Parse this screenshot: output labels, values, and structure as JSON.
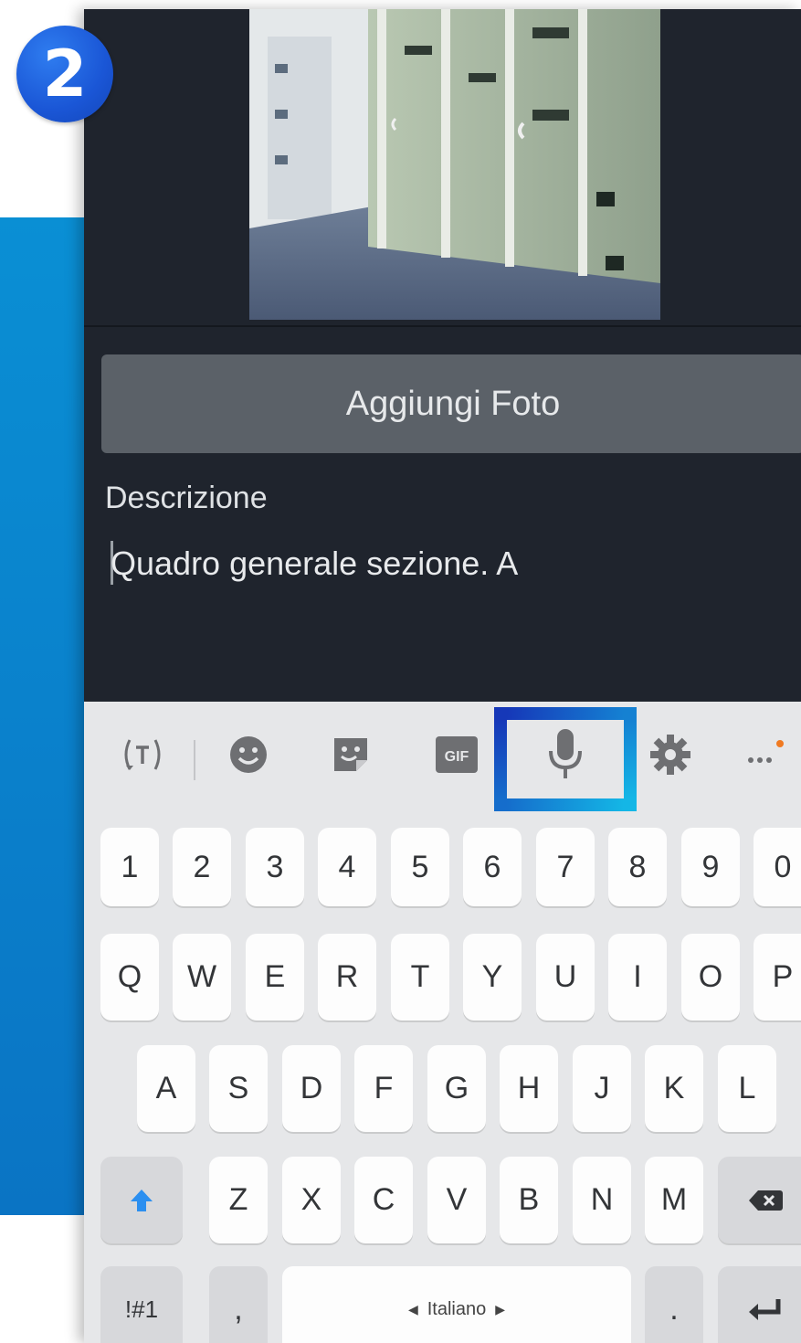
{
  "step": {
    "number": "2"
  },
  "form": {
    "add_photo_button": "Aggiungi Foto",
    "description_label": "Descrizione",
    "description_value": "Quadro generale sezione. A"
  },
  "keyboard": {
    "toolbar": [
      "text-translate-icon",
      "emoji-icon",
      "sticker-icon",
      "gif-icon",
      "microphone-icon",
      "settings-gear-icon",
      "more-options-icon"
    ],
    "gif_label": "GIF",
    "number_row": [
      "1",
      "2",
      "3",
      "4",
      "5",
      "6",
      "7",
      "8",
      "9",
      "0"
    ],
    "row1": [
      "Q",
      "W",
      "E",
      "R",
      "T",
      "Y",
      "U",
      "I",
      "O",
      "P"
    ],
    "row2": [
      "A",
      "S",
      "D",
      "F",
      "G",
      "H",
      "J",
      "K",
      "L"
    ],
    "row3": [
      "Z",
      "X",
      "C",
      "V",
      "B",
      "N",
      "M"
    ],
    "symbols_key": "!#1",
    "comma_key": ",",
    "space_label": "Italiano",
    "period_key": "."
  },
  "colors": {
    "accent_blue": "#0a8fd4",
    "badge_blue": "#1a56d6",
    "highlight_gradient_start": "#1637b8",
    "highlight_gradient_end": "#14b7e6",
    "app_background": "#1f242d",
    "keyboard_background": "#e6e7e9",
    "shift_arrow": "#2b8ff0"
  }
}
